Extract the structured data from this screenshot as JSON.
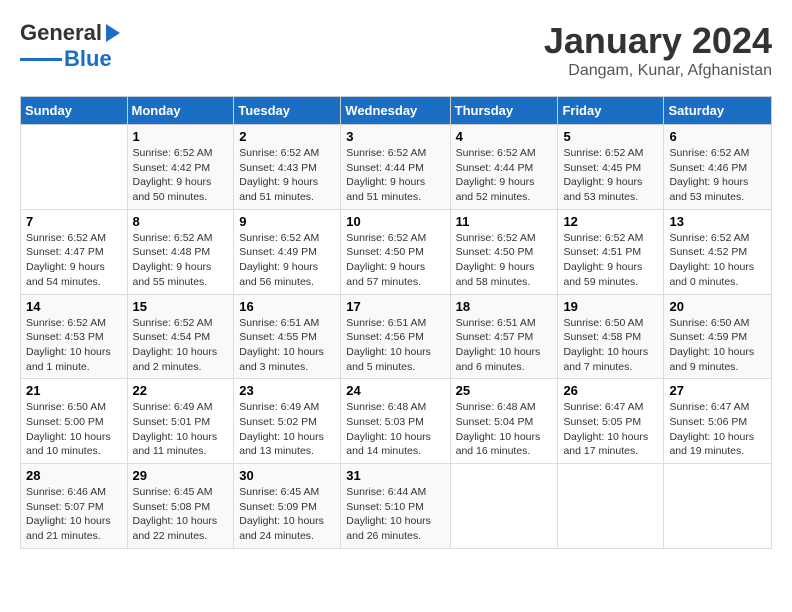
{
  "logo": {
    "text1": "General",
    "text2": "Blue"
  },
  "title": "January 2024",
  "subtitle": "Dangam, Kunar, Afghanistan",
  "days_of_week": [
    "Sunday",
    "Monday",
    "Tuesday",
    "Wednesday",
    "Thursday",
    "Friday",
    "Saturday"
  ],
  "weeks": [
    [
      {
        "day": "",
        "sunrise": "",
        "sunset": "",
        "daylight": ""
      },
      {
        "day": "1",
        "sunrise": "Sunrise: 6:52 AM",
        "sunset": "Sunset: 4:42 PM",
        "daylight": "Daylight: 9 hours and 50 minutes."
      },
      {
        "day": "2",
        "sunrise": "Sunrise: 6:52 AM",
        "sunset": "Sunset: 4:43 PM",
        "daylight": "Daylight: 9 hours and 51 minutes."
      },
      {
        "day": "3",
        "sunrise": "Sunrise: 6:52 AM",
        "sunset": "Sunset: 4:44 PM",
        "daylight": "Daylight: 9 hours and 51 minutes."
      },
      {
        "day": "4",
        "sunrise": "Sunrise: 6:52 AM",
        "sunset": "Sunset: 4:44 PM",
        "daylight": "Daylight: 9 hours and 52 minutes."
      },
      {
        "day": "5",
        "sunrise": "Sunrise: 6:52 AM",
        "sunset": "Sunset: 4:45 PM",
        "daylight": "Daylight: 9 hours and 53 minutes."
      },
      {
        "day": "6",
        "sunrise": "Sunrise: 6:52 AM",
        "sunset": "Sunset: 4:46 PM",
        "daylight": "Daylight: 9 hours and 53 minutes."
      }
    ],
    [
      {
        "day": "7",
        "sunrise": "Sunrise: 6:52 AM",
        "sunset": "Sunset: 4:47 PM",
        "daylight": "Daylight: 9 hours and 54 minutes."
      },
      {
        "day": "8",
        "sunrise": "Sunrise: 6:52 AM",
        "sunset": "Sunset: 4:48 PM",
        "daylight": "Daylight: 9 hours and 55 minutes."
      },
      {
        "day": "9",
        "sunrise": "Sunrise: 6:52 AM",
        "sunset": "Sunset: 4:49 PM",
        "daylight": "Daylight: 9 hours and 56 minutes."
      },
      {
        "day": "10",
        "sunrise": "Sunrise: 6:52 AM",
        "sunset": "Sunset: 4:50 PM",
        "daylight": "Daylight: 9 hours and 57 minutes."
      },
      {
        "day": "11",
        "sunrise": "Sunrise: 6:52 AM",
        "sunset": "Sunset: 4:50 PM",
        "daylight": "Daylight: 9 hours and 58 minutes."
      },
      {
        "day": "12",
        "sunrise": "Sunrise: 6:52 AM",
        "sunset": "Sunset: 4:51 PM",
        "daylight": "Daylight: 9 hours and 59 minutes."
      },
      {
        "day": "13",
        "sunrise": "Sunrise: 6:52 AM",
        "sunset": "Sunset: 4:52 PM",
        "daylight": "Daylight: 10 hours and 0 minutes."
      }
    ],
    [
      {
        "day": "14",
        "sunrise": "Sunrise: 6:52 AM",
        "sunset": "Sunset: 4:53 PM",
        "daylight": "Daylight: 10 hours and 1 minute."
      },
      {
        "day": "15",
        "sunrise": "Sunrise: 6:52 AM",
        "sunset": "Sunset: 4:54 PM",
        "daylight": "Daylight: 10 hours and 2 minutes."
      },
      {
        "day": "16",
        "sunrise": "Sunrise: 6:51 AM",
        "sunset": "Sunset: 4:55 PM",
        "daylight": "Daylight: 10 hours and 3 minutes."
      },
      {
        "day": "17",
        "sunrise": "Sunrise: 6:51 AM",
        "sunset": "Sunset: 4:56 PM",
        "daylight": "Daylight: 10 hours and 5 minutes."
      },
      {
        "day": "18",
        "sunrise": "Sunrise: 6:51 AM",
        "sunset": "Sunset: 4:57 PM",
        "daylight": "Daylight: 10 hours and 6 minutes."
      },
      {
        "day": "19",
        "sunrise": "Sunrise: 6:50 AM",
        "sunset": "Sunset: 4:58 PM",
        "daylight": "Daylight: 10 hours and 7 minutes."
      },
      {
        "day": "20",
        "sunrise": "Sunrise: 6:50 AM",
        "sunset": "Sunset: 4:59 PM",
        "daylight": "Daylight: 10 hours and 9 minutes."
      }
    ],
    [
      {
        "day": "21",
        "sunrise": "Sunrise: 6:50 AM",
        "sunset": "Sunset: 5:00 PM",
        "daylight": "Daylight: 10 hours and 10 minutes."
      },
      {
        "day": "22",
        "sunrise": "Sunrise: 6:49 AM",
        "sunset": "Sunset: 5:01 PM",
        "daylight": "Daylight: 10 hours and 11 minutes."
      },
      {
        "day": "23",
        "sunrise": "Sunrise: 6:49 AM",
        "sunset": "Sunset: 5:02 PM",
        "daylight": "Daylight: 10 hours and 13 minutes."
      },
      {
        "day": "24",
        "sunrise": "Sunrise: 6:48 AM",
        "sunset": "Sunset: 5:03 PM",
        "daylight": "Daylight: 10 hours and 14 minutes."
      },
      {
        "day": "25",
        "sunrise": "Sunrise: 6:48 AM",
        "sunset": "Sunset: 5:04 PM",
        "daylight": "Daylight: 10 hours and 16 minutes."
      },
      {
        "day": "26",
        "sunrise": "Sunrise: 6:47 AM",
        "sunset": "Sunset: 5:05 PM",
        "daylight": "Daylight: 10 hours and 17 minutes."
      },
      {
        "day": "27",
        "sunrise": "Sunrise: 6:47 AM",
        "sunset": "Sunset: 5:06 PM",
        "daylight": "Daylight: 10 hours and 19 minutes."
      }
    ],
    [
      {
        "day": "28",
        "sunrise": "Sunrise: 6:46 AM",
        "sunset": "Sunset: 5:07 PM",
        "daylight": "Daylight: 10 hours and 21 minutes."
      },
      {
        "day": "29",
        "sunrise": "Sunrise: 6:45 AM",
        "sunset": "Sunset: 5:08 PM",
        "daylight": "Daylight: 10 hours and 22 minutes."
      },
      {
        "day": "30",
        "sunrise": "Sunrise: 6:45 AM",
        "sunset": "Sunset: 5:09 PM",
        "daylight": "Daylight: 10 hours and 24 minutes."
      },
      {
        "day": "31",
        "sunrise": "Sunrise: 6:44 AM",
        "sunset": "Sunset: 5:10 PM",
        "daylight": "Daylight: 10 hours and 26 minutes."
      },
      {
        "day": "",
        "sunrise": "",
        "sunset": "",
        "daylight": ""
      },
      {
        "day": "",
        "sunrise": "",
        "sunset": "",
        "daylight": ""
      },
      {
        "day": "",
        "sunrise": "",
        "sunset": "",
        "daylight": ""
      }
    ]
  ]
}
